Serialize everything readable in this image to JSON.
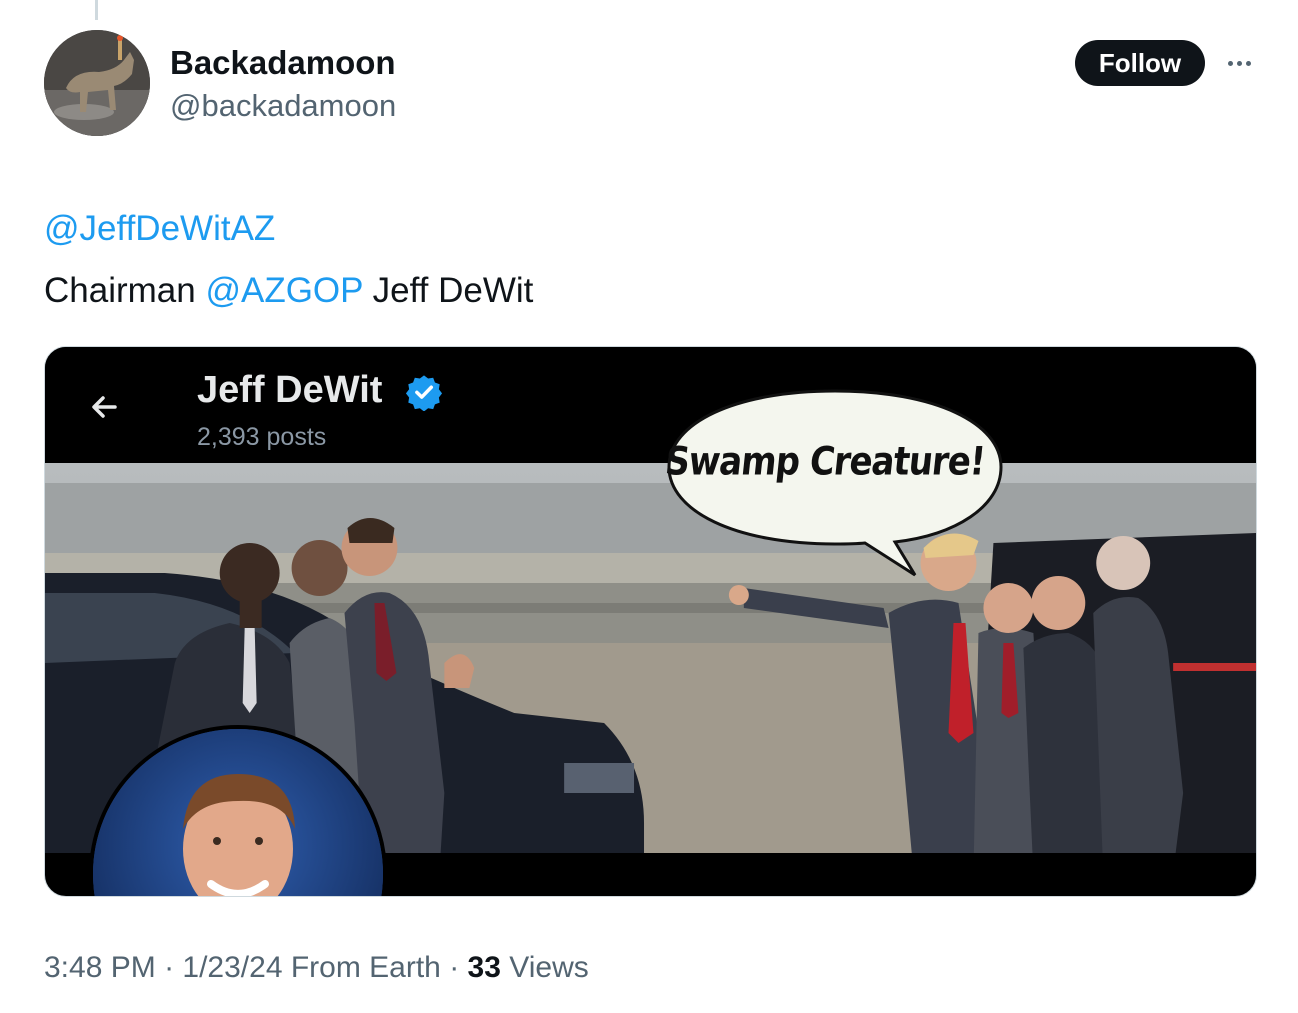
{
  "author": {
    "display_name": "Backadamoon",
    "handle": "@backadamoon"
  },
  "actions": {
    "follow_label": "Follow",
    "more_icon": "more-icon"
  },
  "tweet": {
    "line1_mention": "@JeffDeWitAZ",
    "line2_prefix": "Chairman ",
    "line2_mention": "@AZGOP",
    "line2_suffix": " Jeff DeWit"
  },
  "media": {
    "profile_name": "Jeff DeWit",
    "posts_count": "2,393 posts",
    "speech_bubble": "Swamp Creature!",
    "back_icon": "arrow-left-icon",
    "verified_icon": "verified-badge-icon"
  },
  "meta": {
    "time": "3:48 PM",
    "separator1": " · ",
    "date": "1/23/24",
    "source": " From Earth",
    "separator2": " · ",
    "views_count": "33",
    "views_label": " Views"
  },
  "colors": {
    "mention": "#1d9bf0",
    "follow_bg": "#0f1419",
    "verified": "#1d9bf0",
    "secondary_text": "#536471"
  }
}
